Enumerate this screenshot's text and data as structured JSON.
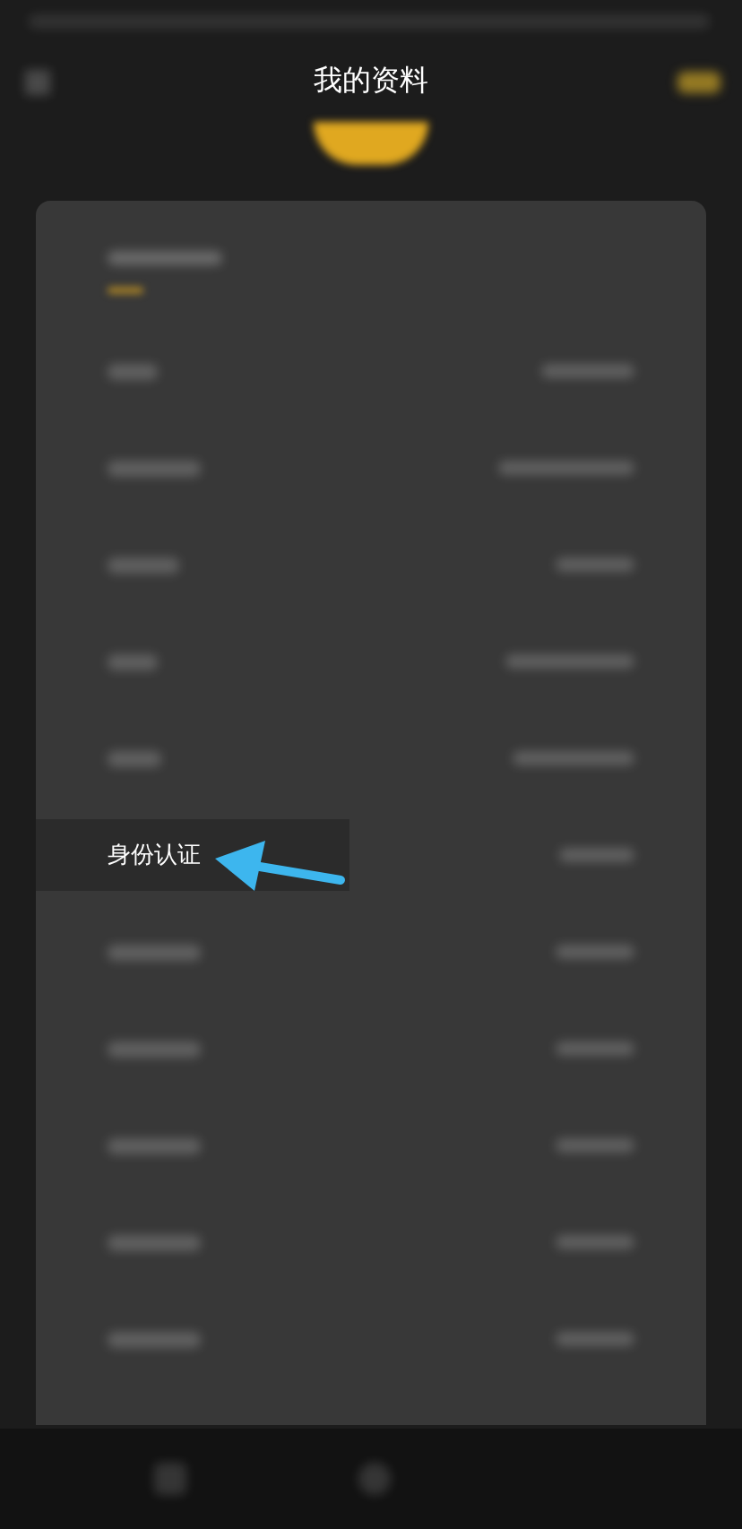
{
  "header": {
    "title": "我的资料"
  },
  "rows": [
    {
      "kind": "blurred"
    },
    {
      "kind": "blurred"
    },
    {
      "kind": "blurred"
    },
    {
      "kind": "blurred"
    },
    {
      "kind": "blurred"
    },
    {
      "kind": "clear",
      "label": "身份认证"
    },
    {
      "kind": "blurred"
    },
    {
      "kind": "blurred"
    },
    {
      "kind": "blurred"
    },
    {
      "kind": "blurred"
    },
    {
      "kind": "blurred"
    }
  ]
}
